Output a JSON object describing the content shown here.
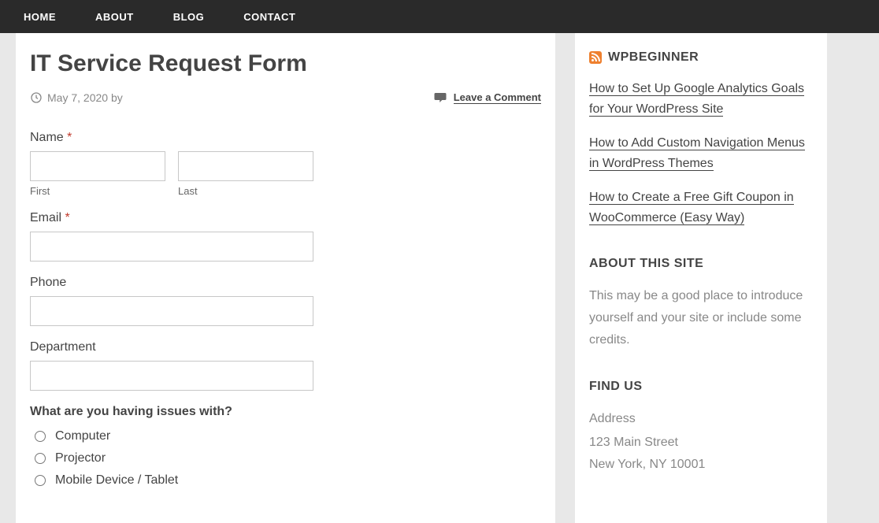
{
  "nav": {
    "items": [
      "HOME",
      "ABOUT",
      "BLOG",
      "CONTACT"
    ]
  },
  "post": {
    "title": "IT Service Request Form",
    "date": "May 7, 2020",
    "by_label": "by",
    "leave_comment": "Leave a Comment"
  },
  "form": {
    "name": {
      "label": "Name",
      "first_sublabel": "First",
      "last_sublabel": "Last",
      "required": "*"
    },
    "email": {
      "label": "Email",
      "required": "*"
    },
    "phone": {
      "label": "Phone"
    },
    "department": {
      "label": "Department"
    },
    "issues": {
      "label": "What are you having issues with?",
      "options": [
        "Computer",
        "Projector",
        "Mobile Device / Tablet"
      ]
    }
  },
  "sidebar": {
    "feed_title": "WPBEGINNER",
    "feed_items": [
      "How to Set Up Google Analytics Goals for Your WordPress Site",
      "How to Add Custom Navigation Menus in WordPress Themes",
      "How to Create a Free Gift Coupon in WooCommerce (Easy Way)"
    ],
    "about_title": "ABOUT THIS SITE",
    "about_text": "This may be a good place to introduce yourself and your site or include some credits.",
    "findus_title": "FIND US",
    "address_label": "Address",
    "address_line1": "123 Main Street",
    "address_line2": "New York, NY 10001"
  }
}
